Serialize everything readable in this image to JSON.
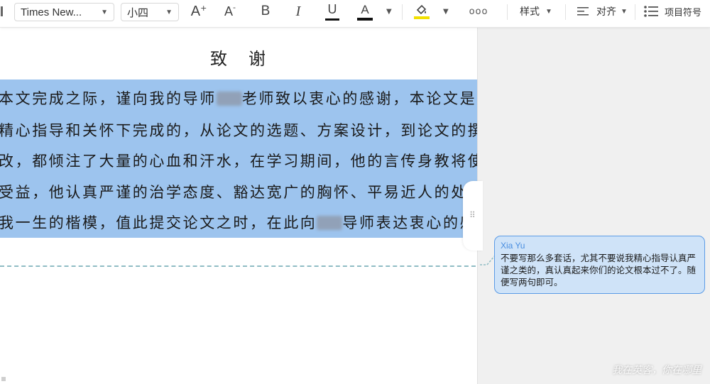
{
  "toolbar": {
    "font_family": "Times New...",
    "font_size": "小四",
    "grow_font_icon_label": "A",
    "shrink_font_icon_label": "A",
    "bold_label": "B",
    "italic_label": "I",
    "underline_label": "U",
    "font_color_label": "A",
    "more_label": "ooo",
    "styles_label": "样式",
    "align_label": "对齐",
    "list_label": "项目符号",
    "colors": {
      "font_color": "#111111",
      "highlight": "#f2e000"
    }
  },
  "document": {
    "heading": "致谢",
    "lines": [
      [
        "本文完成之际，谨向我的导师",
        "老师致以衷心的感谢，本论文是"
      ],
      [
        "精心指导和关怀下完成的，从论文的选题、方案设计，到论文的撰"
      ],
      [
        "改，都倾注了大量的心血和汗水，在学习期间，他的言传身教将使"
      ],
      [
        "受益，他认真严谨的治学态度、豁达宽广的胸怀、平易近人的处"
      ],
      [
        "我一生的楷模，值此提交论文之时，在此向",
        "导师表达衷心的感"
      ]
    ],
    "selection_color": "#9dc4ee"
  },
  "comment": {
    "author": "Xia Yu",
    "text": "不要写那么多套话，尤其不要说我精心指导认真严谨之类的，真认真起来你们的论文根本过不了。随便写两句即可。",
    "border_color": "#5b9be6",
    "background": "#cfe3f8"
  },
  "watermark": "我在英客，你在哪里"
}
